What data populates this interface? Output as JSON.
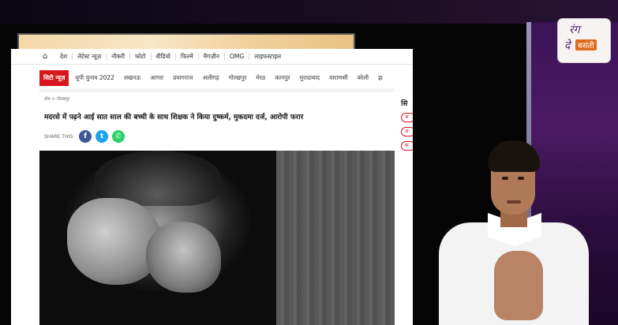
{
  "channel": {
    "logo_line1": "रंग",
    "logo_line2": "दे",
    "logo_badge": "बसंती"
  },
  "browser": {
    "top_nav": {
      "items": [
        "देश",
        "लेटेस्ट न्यूज़",
        "नौकरी",
        "फोटो",
        "वीडियो",
        "फिल्में",
        "मैगज़ीन",
        "OMG",
        "लाइफस्टाइल"
      ]
    },
    "city_nav": {
      "brand": "सिटी न्यूज़",
      "items": [
        "यूपी चुनाव 2022",
        "लखनऊ",
        "आगरा",
        "प्रयागराज",
        "अलीगढ़",
        "गोरखपुर",
        "मेरठ",
        "कानपुर",
        "मुरादाबाद",
        "वाराणसी",
        "बरेली",
        "झ"
      ]
    },
    "article": {
      "breadcrumb": "होम > गोरखपुर",
      "headline": "मदरसे में पढ़ने आई सात साल की बच्ची के साथ शिक्षक ने किया दुष्कर्म, मुकदमा दर्ज, आरोपी फरार",
      "share_label": "SHARE THIS:"
    },
    "sidebar": {
      "title": "सि",
      "pills": [
        "अ",
        "अ",
        "क"
      ]
    }
  },
  "icons": {
    "home": "home-icon",
    "facebook": "facebook-icon",
    "twitter": "twitter-icon",
    "whatsapp": "whatsapp-icon"
  },
  "colors": {
    "brand_red": "#d8171c",
    "facebook": "#3b5998",
    "twitter": "#1da1f2",
    "whatsapp": "#25d366",
    "panel_purple": "#3b1355"
  }
}
